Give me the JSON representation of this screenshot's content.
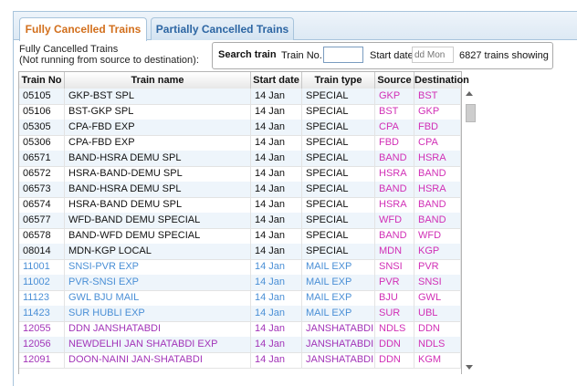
{
  "tabs": [
    {
      "label": "Fully Cancelled Trains"
    },
    {
      "label": "Partially Cancelled Trains"
    }
  ],
  "heading": {
    "line1": "Fully Cancelled Trains",
    "line2": "(Not running from source to destination):"
  },
  "search": {
    "title": "Search train",
    "train_no_label": "Train No.",
    "train_no_value": "",
    "start_date_label": "Start date",
    "start_date_placeholder": "dd Mon",
    "count_text": "6827 trains showing"
  },
  "table": {
    "headers": [
      "Train No",
      "Train name",
      "Start date",
      "Train type",
      "Source",
      "Destination"
    ],
    "colors": {
      "special": "#111111",
      "mail_exp": "#4a8fd6",
      "janshatabdi": "#a234b8",
      "station": "#d12fb6"
    },
    "rows": [
      {
        "no": "05105",
        "name": "GKP-BST SPL",
        "date": "14 Jan",
        "type": "SPECIAL",
        "src": "GKP",
        "dst": "BST",
        "style": "special"
      },
      {
        "no": "05106",
        "name": "BST-GKP SPL",
        "date": "14 Jan",
        "type": "SPECIAL",
        "src": "BST",
        "dst": "GKP",
        "style": "special"
      },
      {
        "no": "05305",
        "name": "CPA-FBD EXP",
        "date": "14 Jan",
        "type": "SPECIAL",
        "src": "CPA",
        "dst": "FBD",
        "style": "special"
      },
      {
        "no": "05306",
        "name": "CPA-FBD EXP",
        "date": "14 Jan",
        "type": "SPECIAL",
        "src": "FBD",
        "dst": "CPA",
        "style": "special"
      },
      {
        "no": "06571",
        "name": "BAND-HSRA DEMU SPL",
        "date": "14 Jan",
        "type": "SPECIAL",
        "src": "BAND",
        "dst": "HSRA",
        "style": "special"
      },
      {
        "no": "06572",
        "name": "HSRA-BAND-DEMU SPL",
        "date": "14 Jan",
        "type": "SPECIAL",
        "src": "HSRA",
        "dst": "BAND",
        "style": "special"
      },
      {
        "no": "06573",
        "name": "BAND-HSRA DEMU SPL",
        "date": "14 Jan",
        "type": "SPECIAL",
        "src": "BAND",
        "dst": "HSRA",
        "style": "special"
      },
      {
        "no": "06574",
        "name": "HSRA-BAND DEMU SPL",
        "date": "14 Jan",
        "type": "SPECIAL",
        "src": "HSRA",
        "dst": "BAND",
        "style": "special"
      },
      {
        "no": "06577",
        "name": "WFD-BAND DEMU SPECIAL",
        "date": "14 Jan",
        "type": "SPECIAL",
        "src": "WFD",
        "dst": "BAND",
        "style": "special"
      },
      {
        "no": "06578",
        "name": "BAND-WFD DEMU SPECIAL",
        "date": "14 Jan",
        "type": "SPECIAL",
        "src": "BAND",
        "dst": "WFD",
        "style": "special"
      },
      {
        "no": "08014",
        "name": "MDN-KGP LOCAL",
        "date": "14 Jan",
        "type": "SPECIAL",
        "src": "MDN",
        "dst": "KGP",
        "style": "special"
      },
      {
        "no": "11001",
        "name": "SNSI-PVR EXP",
        "date": "14 Jan",
        "type": "MAIL EXP",
        "src": "SNSI",
        "dst": "PVR",
        "style": "mail_exp"
      },
      {
        "no": "11002",
        "name": "PVR-SNSI EXP",
        "date": "14 Jan",
        "type": "MAIL EXP",
        "src": "PVR",
        "dst": "SNSI",
        "style": "mail_exp"
      },
      {
        "no": "11123",
        "name": "GWL BJU MAIL",
        "date": "14 Jan",
        "type": "MAIL EXP",
        "src": "BJU",
        "dst": "GWL",
        "style": "mail_exp"
      },
      {
        "no": "11423",
        "name": "SUR HUBLI EXP",
        "date": "14 Jan",
        "type": "MAIL EXP",
        "src": "SUR",
        "dst": "UBL",
        "style": "mail_exp"
      },
      {
        "no": "12055",
        "name": "DDN JANSHATABDI",
        "date": "14 Jan",
        "type": "JANSHATABDI",
        "src": "NDLS",
        "dst": "DDN",
        "style": "janshatabdi"
      },
      {
        "no": "12056",
        "name": "NEWDELHI JAN SHATABDI EXP",
        "date": "14 Jan",
        "type": "JANSHATABDI",
        "src": "DDN",
        "dst": "NDLS",
        "style": "janshatabdi"
      },
      {
        "no": "12091",
        "name": "DOON-NAINI JAN-SHATABDI",
        "date": "14 Jan",
        "type": "JANSHATABDI",
        "src": "DDN",
        "dst": "KGM",
        "style": "janshatabdi"
      }
    ]
  }
}
